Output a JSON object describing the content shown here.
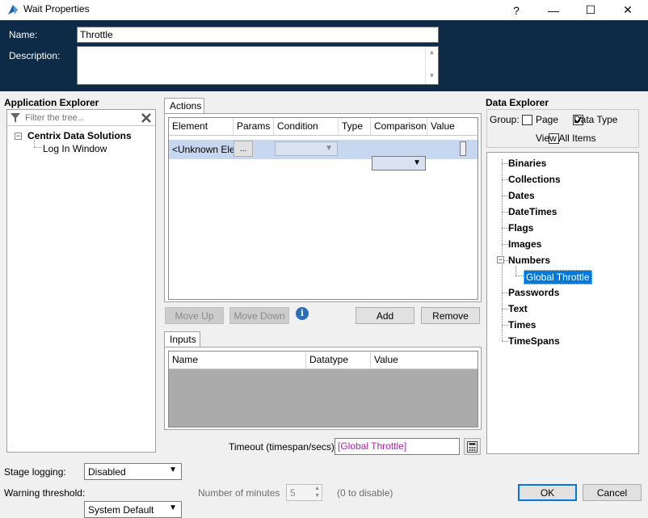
{
  "window": {
    "title": "Wait Properties",
    "help": "?",
    "minimize": "—",
    "maximize": "☐",
    "close": "✕"
  },
  "header": {
    "name_label": "Name:",
    "name_value": "Throttle",
    "description_label": "Description:",
    "description_value": ""
  },
  "app_explorer": {
    "title": "Application Explorer",
    "filter_placeholder": "Filter the tree...",
    "tree": [
      {
        "label": "Centrix Data Solutions",
        "expander": "−"
      },
      {
        "label": "Log In Window"
      }
    ]
  },
  "actions": {
    "tab": "Actions",
    "columns": [
      "Element",
      "Params",
      "Condition",
      "Type",
      "Comparison",
      "Value"
    ],
    "row": {
      "element": "<Unknown Elem",
      "params": "...",
      "condition": "",
      "type": "",
      "comparison": "",
      "value": ""
    },
    "move_up": "Move Up",
    "move_down": "Move Down",
    "info_icon": "i",
    "add": "Add",
    "remove": "Remove"
  },
  "inputs": {
    "tab": "Inputs",
    "columns": [
      "Name",
      "Datatype",
      "Value"
    ]
  },
  "timeout": {
    "label": "Timeout (timespan/secs):",
    "value": "[Global Throttle]"
  },
  "data_explorer": {
    "title": "Data Explorer",
    "group_label": "Group:",
    "page_label": "Page",
    "page_checked": false,
    "datatype_label": "Data Type",
    "datatype_checked": true,
    "view_all_label": "View All Items",
    "view_all_checked": false,
    "items": [
      "Binaries",
      "Collections",
      "Dates",
      "DateTimes",
      "Flags",
      "Images",
      "Numbers",
      "Passwords",
      "Text",
      "Times",
      "TimeSpans"
    ],
    "expanded_item": "Numbers",
    "child_item": "Global Throttle",
    "expander": "−"
  },
  "footer": {
    "stage_logging_label": "Stage logging:",
    "stage_logging_value": "Disabled",
    "warning_label": "Warning threshold:",
    "warning_value": "System Default",
    "minutes_label": "Number of minutes",
    "minutes_value": "5",
    "disable_hint": "(0 to disable)",
    "ok": "OK",
    "cancel": "Cancel"
  },
  "colors": {
    "header_bg": "#0d2a47",
    "selection": "#0078d7",
    "row_highlight": "#c7d7ef",
    "timeout_text": "#b022b0"
  }
}
